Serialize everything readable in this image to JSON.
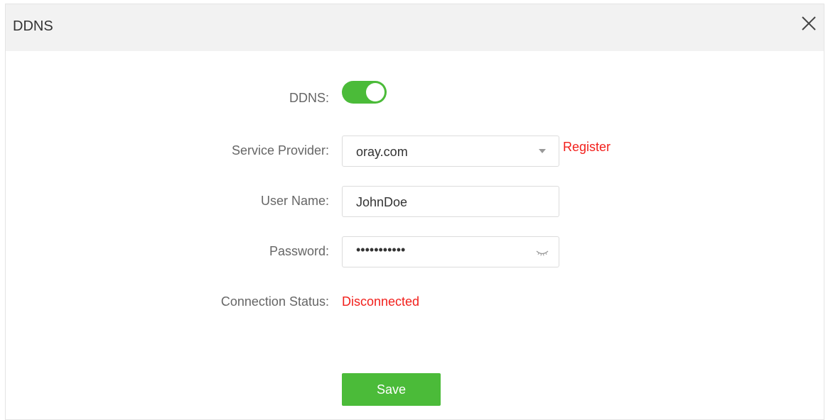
{
  "dialog": {
    "title": "DDNS",
    "close_icon": "close-icon"
  },
  "form": {
    "ddns": {
      "label": "DDNS:",
      "enabled": true,
      "toggle_color": "#4bbb39"
    },
    "service_provider": {
      "label": "Service Provider:",
      "value": "oray.com",
      "register_link": "Register"
    },
    "user_name": {
      "label": "User Name:",
      "value": "JohnDoe"
    },
    "password": {
      "label": "Password:",
      "masked_value": "•••••••••••",
      "toggle_icon": "eye-closed-icon"
    },
    "connection_status": {
      "label": "Connection Status:",
      "value": "Disconnected",
      "status_color": "#f2201c"
    }
  },
  "actions": {
    "save_label": "Save"
  }
}
